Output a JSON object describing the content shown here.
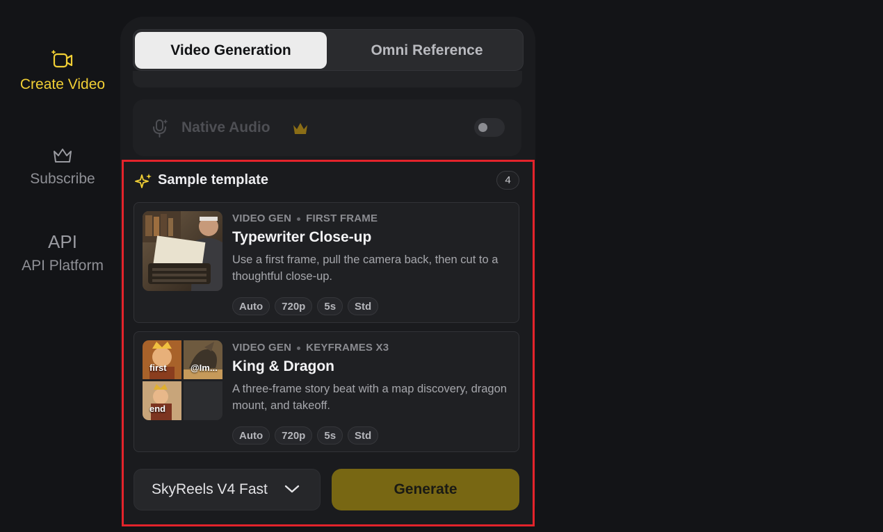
{
  "nav": {
    "create_video": "Create Video",
    "subscribe": "Subscribe",
    "api_glyph": "API",
    "api_platform": "API Platform"
  },
  "tabs": {
    "video_generation": "Video Generation",
    "omni_reference": "Omni Reference"
  },
  "audio": {
    "label": "Native Audio",
    "enabled": false
  },
  "templates": {
    "label": "Sample template",
    "count": "4",
    "cards": [
      {
        "meta_a": "VIDEO GEN",
        "meta_b": "FIRST FRAME",
        "title": "Typewriter Close-up",
        "desc": "Use a first frame, pull the camera back, then cut to a thoughtful close-up.",
        "chips": [
          "Auto",
          "720p",
          "5s",
          "Std"
        ]
      },
      {
        "meta_a": "VIDEO GEN",
        "meta_b": "KEYFRAMES X3",
        "title": "King & Dragon",
        "desc": "A three-frame story beat with a map discovery, dragon mount, and takeoff.",
        "chips": [
          "Auto",
          "720p",
          "5s",
          "Std"
        ],
        "frame_labels": [
          "first",
          "@Im...",
          "end"
        ]
      }
    ]
  },
  "footer": {
    "model": "SkyReels V4 Fast",
    "generate": "Generate"
  },
  "colors": {
    "accent": "#f1cf35",
    "generate_bg": "#786713",
    "highlight": "#e3232b"
  }
}
